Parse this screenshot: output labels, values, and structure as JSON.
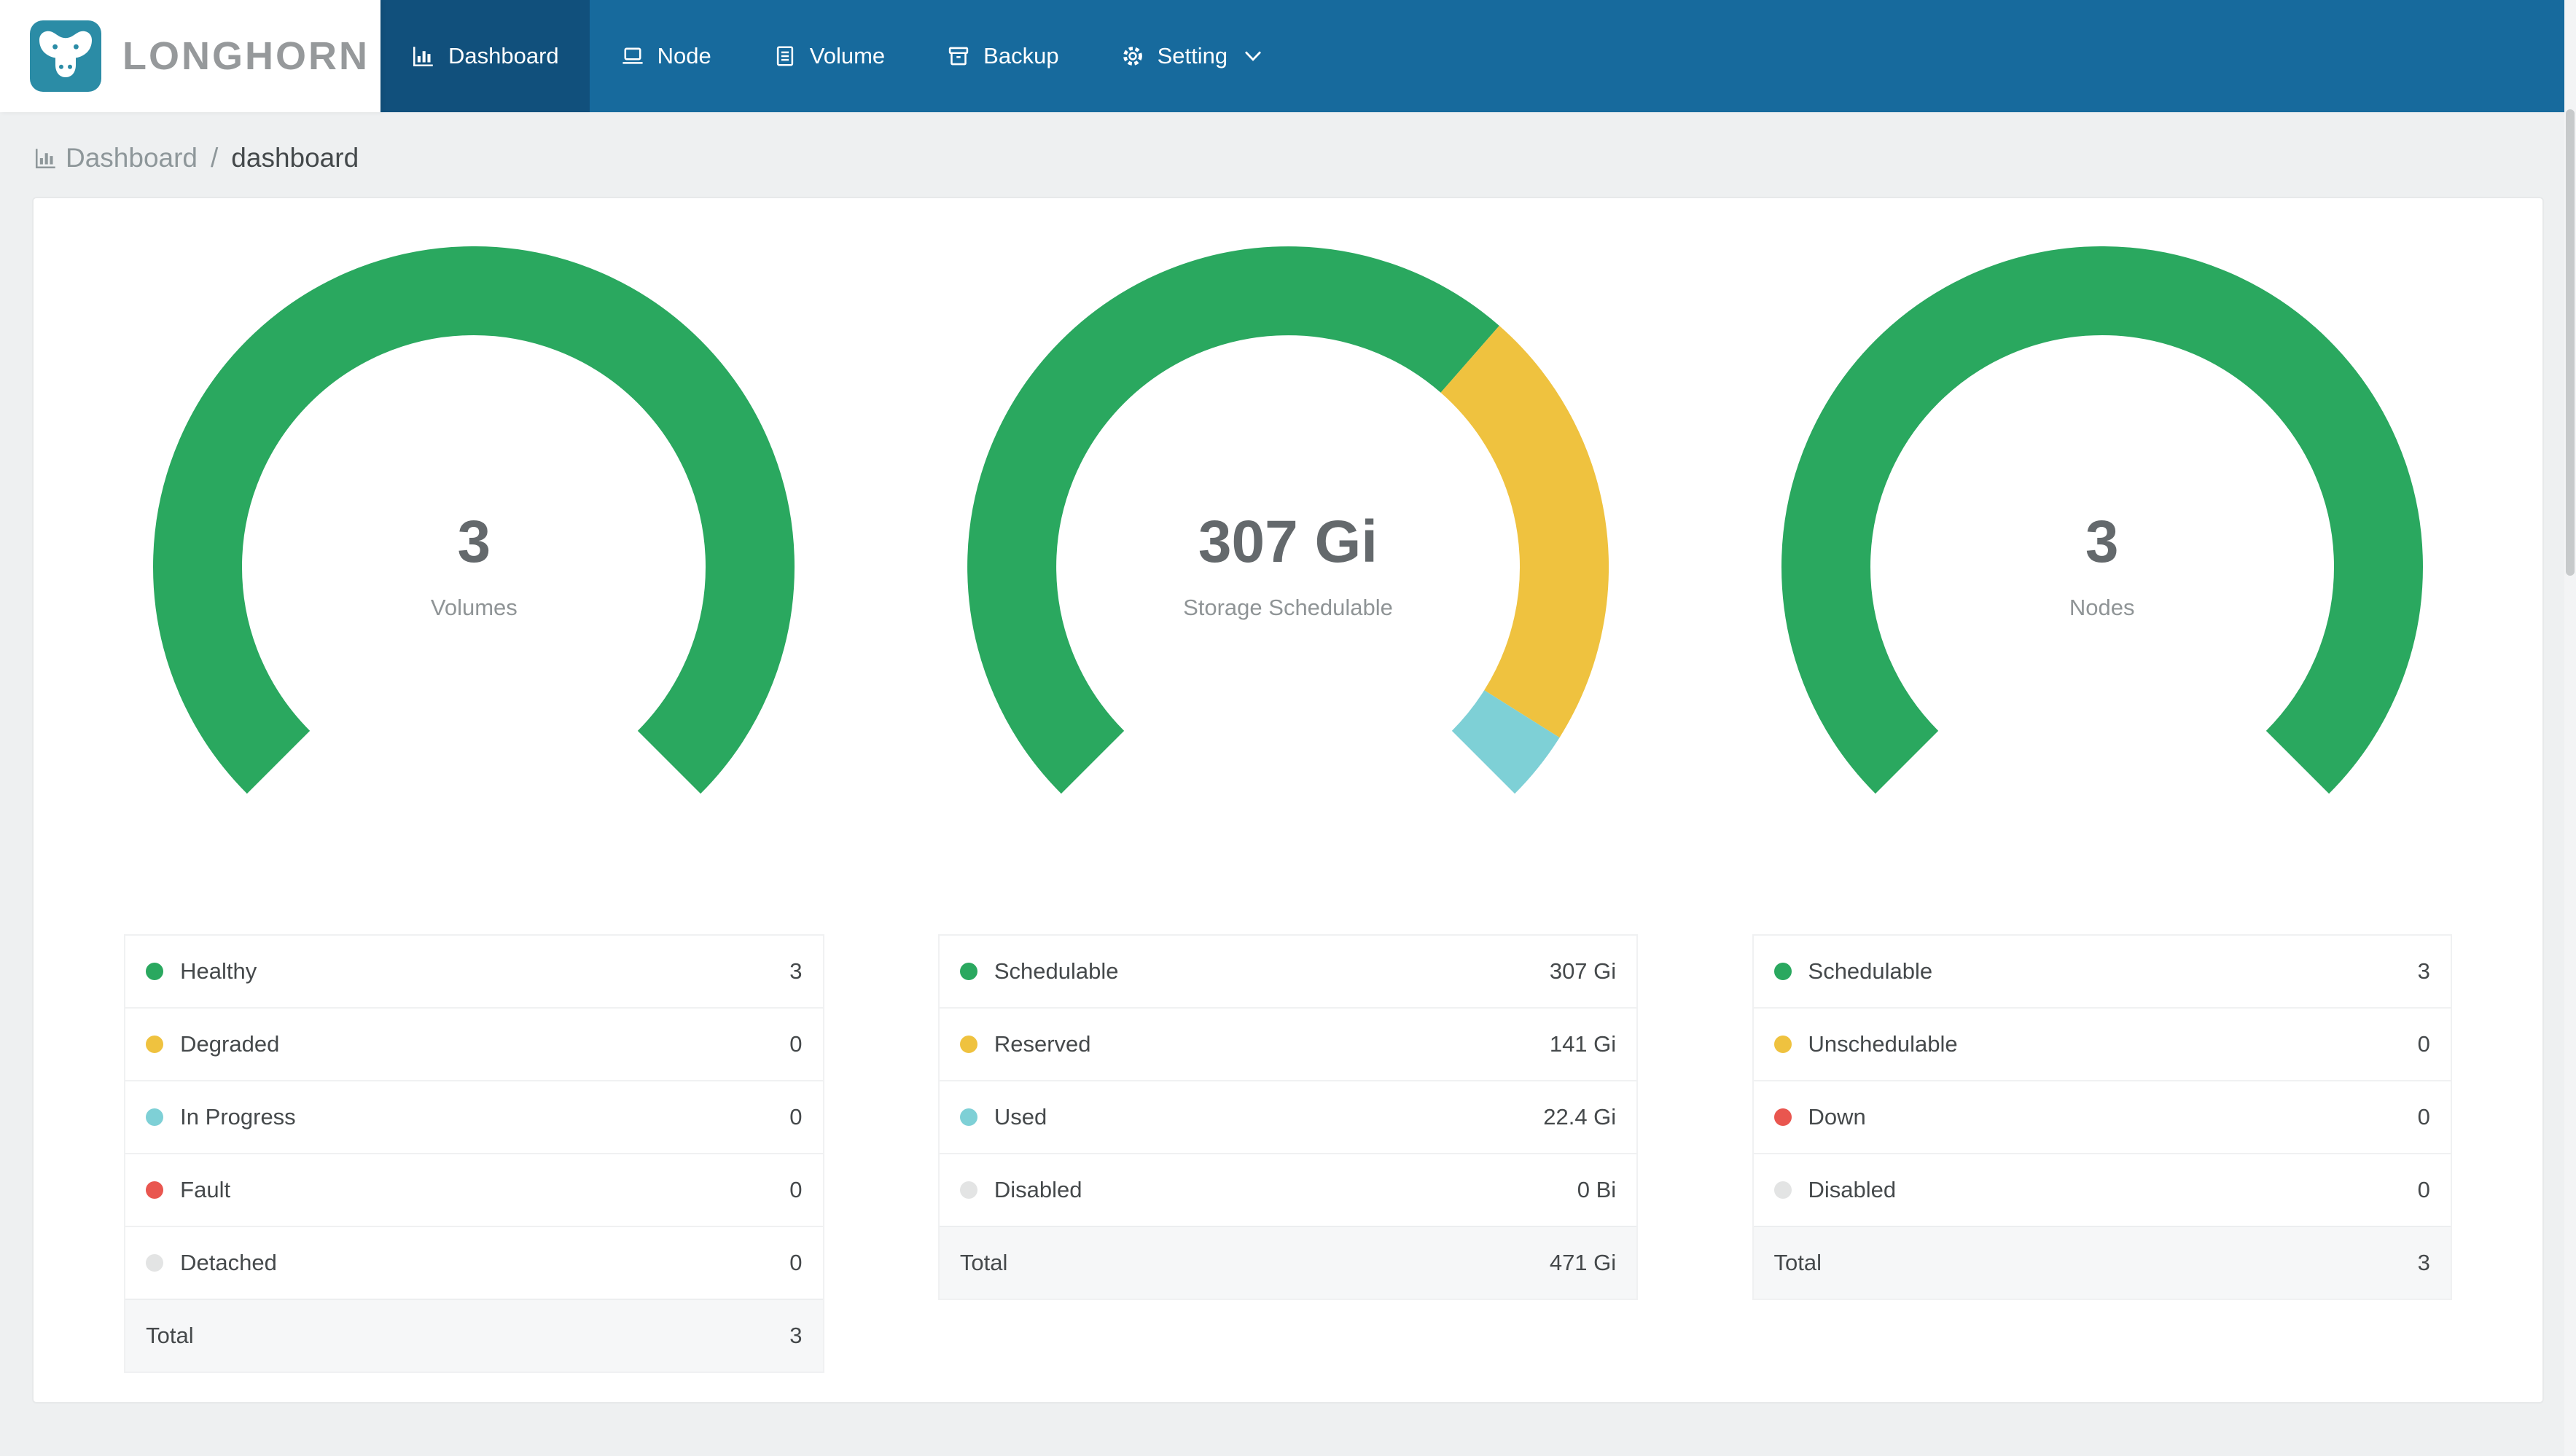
{
  "app": {
    "logo_text": "LONGHORN"
  },
  "nav": {
    "items": [
      {
        "label": "Dashboard",
        "icon": "dashboard-icon",
        "active": true
      },
      {
        "label": "Node",
        "icon": "node-icon",
        "active": false
      },
      {
        "label": "Volume",
        "icon": "volume-icon",
        "active": false
      },
      {
        "label": "Backup",
        "icon": "backup-icon",
        "active": false
      },
      {
        "label": "Setting",
        "icon": "setting-icon",
        "active": false,
        "has_dropdown": true
      }
    ]
  },
  "breadcrumb": {
    "section": "Dashboard",
    "separator": "/",
    "page": "dashboard"
  },
  "colors": {
    "navbar": "#176a9d",
    "navbar_active": "#11507c",
    "logo_tile": "#2b8ca6",
    "green": "#2aa85f",
    "yellow": "#efc23f",
    "teal": "#7ed0d6",
    "red": "#e9564f",
    "gray": "#e3e4e4",
    "page_background": "#eef0f1"
  },
  "chart_data": [
    {
      "type": "gauge",
      "title": "Volumes",
      "center_value": "3",
      "center_label": "Volumes",
      "arc": {
        "start_deg": 225,
        "sweep_deg": 270
      },
      "legend": [
        {
          "label": "Healthy",
          "value": "3",
          "amount": 3,
          "color": "#2aa85f"
        },
        {
          "label": "Degraded",
          "value": "0",
          "amount": 0,
          "color": "#efc23f"
        },
        {
          "label": "In Progress",
          "value": "0",
          "amount": 0,
          "color": "#7ed0d6"
        },
        {
          "label": "Fault",
          "value": "0",
          "amount": 0,
          "color": "#e9564f"
        },
        {
          "label": "Detached",
          "value": "0",
          "amount": 0,
          "color": "#e3e4e4"
        }
      ],
      "total": {
        "label": "Total",
        "value": "3"
      }
    },
    {
      "type": "gauge",
      "title": "Storage Schedulable",
      "center_value": "307 Gi",
      "center_label": "Storage Schedulable",
      "arc": {
        "start_deg": 225,
        "sweep_deg": 270
      },
      "legend": [
        {
          "label": "Schedulable",
          "value": "307 Gi",
          "amount": 307,
          "color": "#2aa85f"
        },
        {
          "label": "Reserved",
          "value": "141 Gi",
          "amount": 141,
          "color": "#efc23f"
        },
        {
          "label": "Used",
          "value": "22.4 Gi",
          "amount": 22.4,
          "color": "#7ed0d6"
        },
        {
          "label": "Disabled",
          "value": "0 Bi",
          "amount": 0,
          "color": "#e3e4e4"
        }
      ],
      "total": {
        "label": "Total",
        "value": "471 Gi"
      }
    },
    {
      "type": "gauge",
      "title": "Nodes",
      "center_value": "3",
      "center_label": "Nodes",
      "arc": {
        "start_deg": 225,
        "sweep_deg": 270
      },
      "legend": [
        {
          "label": "Schedulable",
          "value": "3",
          "amount": 3,
          "color": "#2aa85f"
        },
        {
          "label": "Unschedulable",
          "value": "0",
          "amount": 0,
          "color": "#efc23f"
        },
        {
          "label": "Down",
          "value": "0",
          "amount": 0,
          "color": "#e9564f"
        },
        {
          "label": "Disabled",
          "value": "0",
          "amount": 0,
          "color": "#e3e4e4"
        }
      ],
      "total": {
        "label": "Total",
        "value": "3"
      }
    }
  ]
}
